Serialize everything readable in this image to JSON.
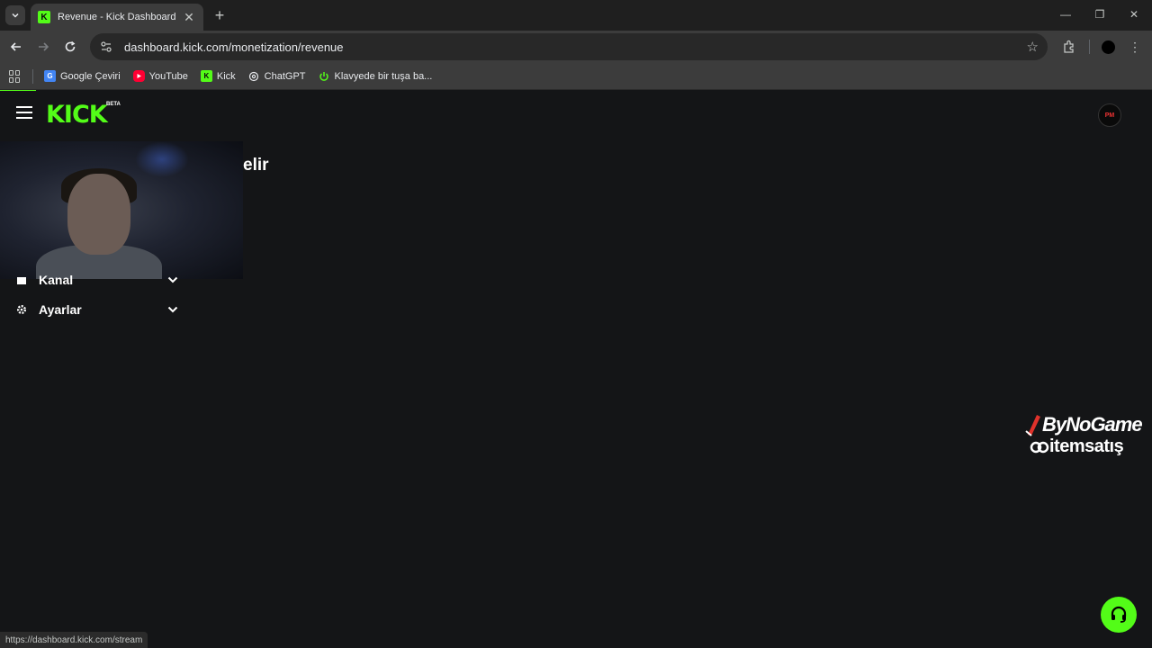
{
  "browser": {
    "tab": {
      "title": "Revenue - Kick Dashboard",
      "favicon_letter": "K",
      "close": "✕"
    },
    "new_tab": "+",
    "window_controls": {
      "minimize": "—",
      "restore": "❐",
      "close": "✕"
    },
    "url": "dashboard.kick.com/monetization/revenue",
    "bookmarks": [
      {
        "label": "Google Çeviri",
        "icon": "google-translate-icon"
      },
      {
        "label": "YouTube",
        "icon": "youtube-icon"
      },
      {
        "label": "Kick",
        "icon": "kick-icon"
      },
      {
        "label": "ChatGPT",
        "icon": "chatgpt-icon"
      },
      {
        "label": "Klavyede bir tuşa ba...",
        "icon": "power-icon"
      }
    ],
    "status_url": "https://dashboard.kick.com/stream"
  },
  "page": {
    "logo_text": "KICK",
    "beta_label": "BETA",
    "heading_partial": "elir",
    "sidebar": [
      {
        "label": "Kanal",
        "icon": "channel-icon"
      },
      {
        "label": "Ayarlar",
        "icon": "gear-icon"
      }
    ],
    "watermark": {
      "line1": "ByNoGame",
      "line2": "itemsatış"
    },
    "avatar_text": "PM"
  },
  "colors": {
    "accent": "#53fc18",
    "background": "#141517",
    "chrome": "#3c3c3c"
  }
}
